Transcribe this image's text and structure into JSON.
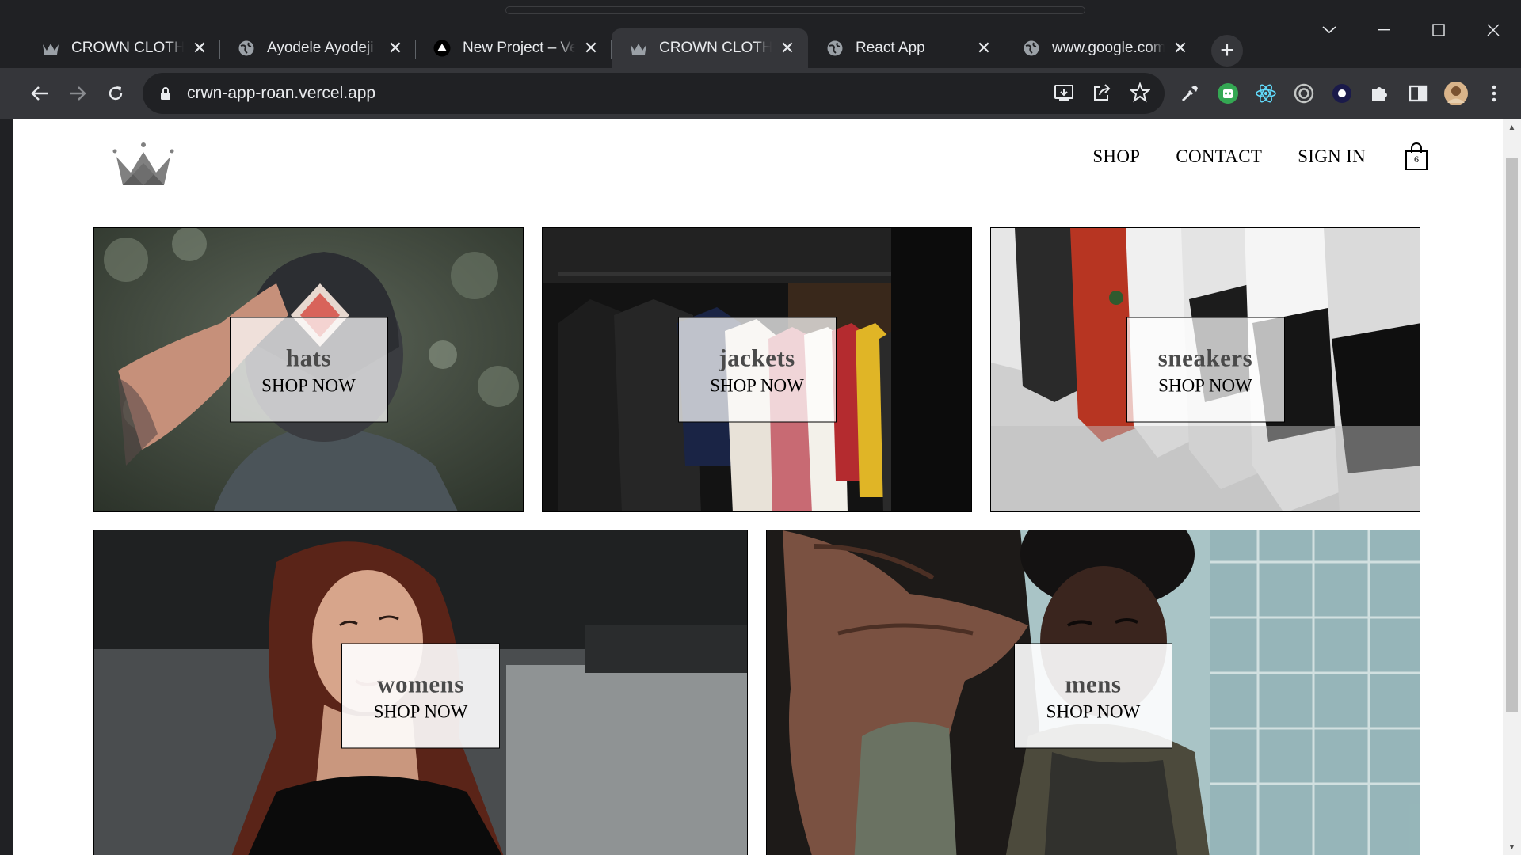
{
  "browser": {
    "tabs": [
      {
        "title": "CROWN CLOTHING",
        "favicon": "crown-icon",
        "active": false
      },
      {
        "title": "Ayodele Ayodeji",
        "favicon": "globe-icon",
        "active": false
      },
      {
        "title": "New Project – Vercel",
        "favicon": "vercel-icon",
        "active": false
      },
      {
        "title": "CROWN CLOTHING",
        "favicon": "crown-icon",
        "active": true
      },
      {
        "title": "React App",
        "favicon": "globe-icon",
        "active": false
      },
      {
        "title": "www.google.com",
        "favicon": "globe-icon",
        "active": false
      }
    ],
    "url": "crwn-app-roan.vercel.app"
  },
  "site": {
    "nav": {
      "shop": "SHOP",
      "contact": "CONTACT",
      "sign_in": "SIGN IN",
      "cart_count": "6"
    },
    "categories": [
      {
        "name": "hats",
        "cta": "SHOP NOW"
      },
      {
        "name": "jackets",
        "cta": "SHOP NOW"
      },
      {
        "name": "sneakers",
        "cta": "SHOP NOW"
      },
      {
        "name": "womens",
        "cta": "SHOP NOW"
      },
      {
        "name": "mens",
        "cta": "SHOP NOW"
      }
    ]
  },
  "colors": {
    "chrome_dark": "#202124",
    "chrome_active": "#35363a",
    "page_bg": "#ffffff"
  }
}
